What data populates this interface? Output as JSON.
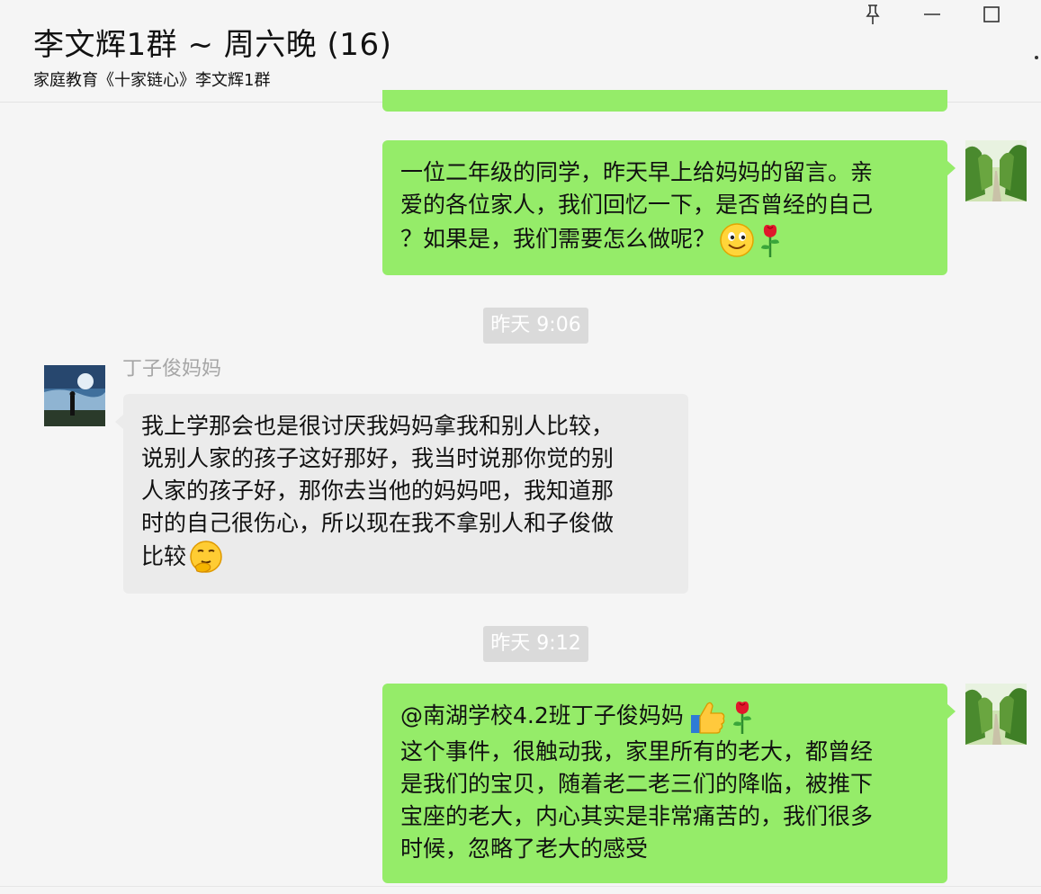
{
  "window": {
    "title": "李文辉1群 ~ 周六晚 (16)",
    "subtitle": "家庭教育《十家链心》李文辉1群",
    "controls": [
      "pin-icon",
      "minimize-icon",
      "maximize-icon"
    ]
  },
  "messages": {
    "m1": {
      "direction": "outgoing",
      "lines": [
        "一位二年级的同学，昨天早上给妈妈的留言。亲",
        "爱的各位家人，我们回忆一下，是否曾经的自己",
        "？如果是，我们需要怎么做呢？"
      ],
      "emojis": [
        "smile-emoji",
        "rose-emoji"
      ]
    },
    "time1": "昨天 9:06",
    "m2": {
      "direction": "incoming",
      "sender": "丁子俊妈妈",
      "lines": [
        "我上学那会也是很讨厌我妈妈拿我和别人比较，",
        "说别人家的孩子这好那好，我当时说那你觉的别",
        "人家的孩子好，那你去当他的妈妈吧，我知道那",
        "时的自己很伤心，所以现在我不拿别人和子俊做",
        "比较"
      ],
      "emojis": [
        "thinking-emoji"
      ]
    },
    "time2": "昨天 9:12",
    "m3": {
      "direction": "outgoing",
      "mention": "@南湖学校4.2班丁子俊妈妈",
      "lines": [
        "这个事件，很触动我，家里所有的老大，都曾经",
        "是我们的宝贝，随着老二老三们的降临，被推下",
        "宝座的老大，内心其实是非常痛苦的，我们很多",
        "时候，忽略了老大的感受"
      ],
      "emojis": [
        "thumbs-up-emoji",
        "rose-emoji"
      ]
    }
  },
  "colors": {
    "outgoing_bubble": "#95ec69",
    "incoming_bubble": "#ebebeb",
    "background": "#f5f5f5",
    "timestamp_bg": "#dadada"
  }
}
